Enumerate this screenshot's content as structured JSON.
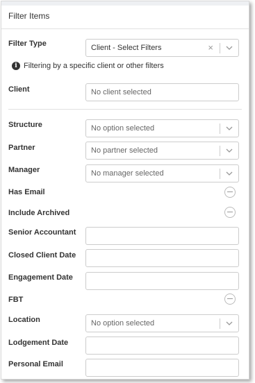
{
  "panel": {
    "title": "Filter Items"
  },
  "filter_type": {
    "label": "Filter Type",
    "value": "Client - Select Filters",
    "clear_glyph": "×",
    "info": "Filtering by a specific client or other filters"
  },
  "client": {
    "label": "Client",
    "placeholder": "No client selected"
  },
  "structure": {
    "label": "Structure",
    "placeholder": "No option selected"
  },
  "partner": {
    "label": "Partner",
    "placeholder": "No partner selected"
  },
  "manager": {
    "label": "Manager",
    "placeholder": "No manager selected"
  },
  "has_email": {
    "label": "Has Email"
  },
  "include_archived": {
    "label": "Include Archived"
  },
  "senior_accountant": {
    "label": "Senior Accountant",
    "value": ""
  },
  "closed_client_date": {
    "label": "Closed Client Date",
    "value": ""
  },
  "engagement_date": {
    "label": "Engagement Date",
    "value": ""
  },
  "fbt": {
    "label": "FBT"
  },
  "location": {
    "label": "Location",
    "placeholder": "No option selected"
  },
  "lodgement_date": {
    "label": "Lodgement Date",
    "value": ""
  },
  "personal_email": {
    "label": "Personal Email",
    "value": ""
  },
  "icons": {
    "info": "info-circle-icon",
    "chevron": "chevron-down-icon",
    "clear": "close-icon",
    "toggle": "minus-circle-icon"
  }
}
